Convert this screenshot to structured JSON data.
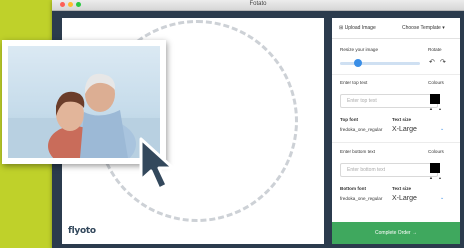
{
  "window": {
    "title": "Fotato"
  },
  "canvas": {
    "logo_text": "flyoto"
  },
  "panel": {
    "tab_upload": "Upload Image",
    "tab_template": "Choose Template",
    "resize_label": "Resize your image",
    "rotate_label": "Rotate",
    "resize_level": 0.22,
    "top_text_label": "Enter top text",
    "top_text_placeholder": "Enter top text",
    "colours_label_1": "Colours",
    "top_font_label": "Top font",
    "top_font_value": "fredoka_one_regular",
    "text_size_label_1": "Text size",
    "top_size_value": "X-Large",
    "bottom_text_label": "Enter bottom text",
    "bottom_text_placeholder": "Enter bottom text",
    "colours_label_2": "Colours",
    "bottom_font_label": "Bottom font",
    "bottom_font_value": "fredoka_one_regular",
    "text_size_label_2": "Text size",
    "bottom_size_value": "X-Large",
    "complete_label": "Complete Order"
  },
  "colors": {
    "accent": "#3a8ee6",
    "complete": "#3fa85e",
    "background": "#bfd12a",
    "window": "#2b3b4d"
  }
}
